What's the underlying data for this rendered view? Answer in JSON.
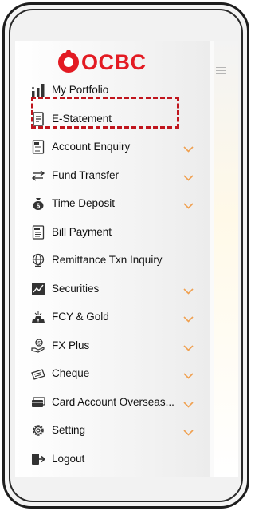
{
  "brand": {
    "name": "OCBC",
    "color": "#e31b23"
  },
  "colors": {
    "chevron": "#f0a050",
    "highlight_border": "#c0151d"
  },
  "menu": [
    {
      "label": "My Portfolio",
      "icon": "bar-chart-icon",
      "has_chevron": false
    },
    {
      "label": "E-Statement",
      "icon": "document-icon",
      "has_chevron": false,
      "highlighted": true
    },
    {
      "label": "Account Enquiry",
      "icon": "acc-document-icon",
      "has_chevron": true
    },
    {
      "label": "Fund Transfer",
      "icon": "transfer-arrows-icon",
      "has_chevron": true
    },
    {
      "label": "Time Deposit",
      "icon": "money-bag-icon",
      "has_chevron": true
    },
    {
      "label": "Bill Payment",
      "icon": "bill-icon",
      "has_chevron": false
    },
    {
      "label": "Remittance Txn Inquiry",
      "icon": "globe-icon",
      "has_chevron": false
    },
    {
      "label": "Securities",
      "icon": "securities-chart-icon",
      "has_chevron": true
    },
    {
      "label": "FCY & Gold",
      "icon": "gold-bars-icon",
      "has_chevron": true
    },
    {
      "label": "FX Plus",
      "icon": "hand-coin-icon",
      "has_chevron": true
    },
    {
      "label": "Cheque",
      "icon": "cheque-icon",
      "has_chevron": true
    },
    {
      "label": "Card Account Overseas...",
      "icon": "card-icon",
      "has_chevron": true
    },
    {
      "label": "Setting",
      "icon": "gear-icon",
      "has_chevron": true
    },
    {
      "label": "Logout",
      "icon": "logout-icon",
      "has_chevron": false
    }
  ]
}
